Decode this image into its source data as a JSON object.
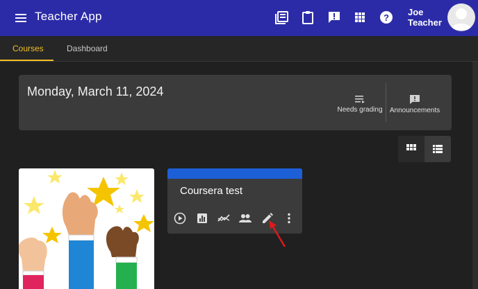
{
  "header": {
    "app_title": "Teacher App",
    "user_name": "Joe Teacher",
    "icons": [
      "menu-icon",
      "library-books-icon",
      "clipboard-icon",
      "feedback-icon",
      "apps-grid-icon",
      "help-icon",
      "avatar"
    ]
  },
  "tabs": [
    {
      "label": "Courses",
      "active": true
    },
    {
      "label": "Dashboard",
      "active": false
    }
  ],
  "date_bar": {
    "date": "Monday, March 11, 2024",
    "needs_grading": "Needs grading",
    "announcements": "Announcements"
  },
  "view_toggle": {
    "selected": "grid",
    "options": [
      "grid",
      "list"
    ]
  },
  "courses": [
    {
      "title": "Coursera test",
      "band_color": "#1d5fd6",
      "actions": [
        "play-icon",
        "chart-icon",
        "trending-icon",
        "people-icon",
        "edit-icon",
        "more-vert-icon"
      ]
    }
  ],
  "colors": {
    "header": "#2b2ba8",
    "accent": "#f4bf26",
    "annotation_arrow": "#e0191d"
  }
}
